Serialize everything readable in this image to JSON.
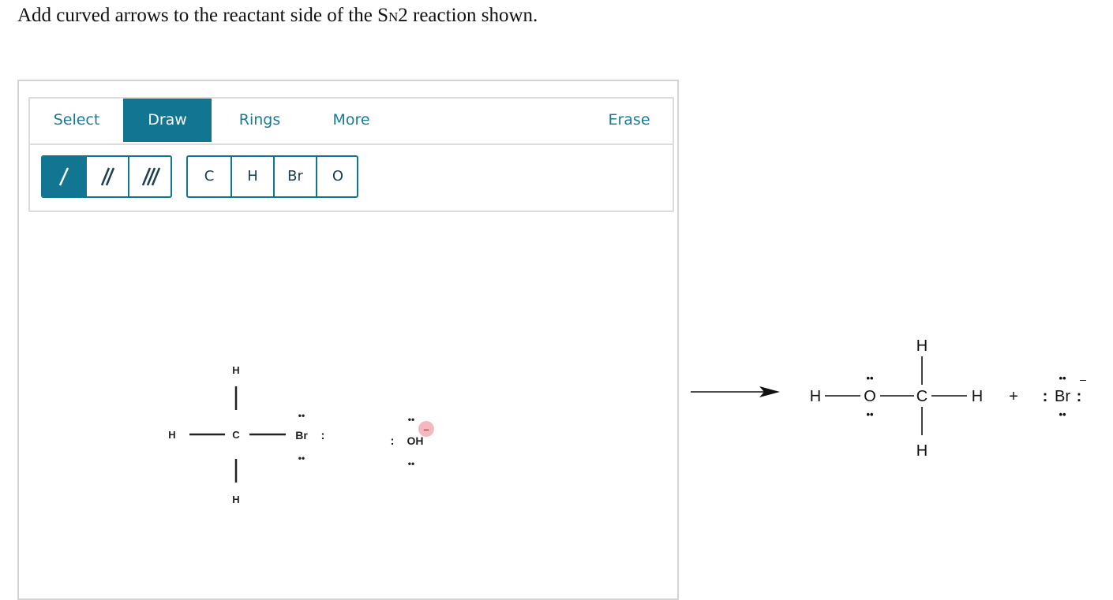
{
  "question": {
    "prefix": "Add curved arrows to the reactant side of the S",
    "subscript": "N",
    "suffix": "2 reaction shown."
  },
  "tabs": [
    {
      "label": "Select",
      "active": false
    },
    {
      "label": "Draw",
      "active": true
    },
    {
      "label": "Rings",
      "active": false
    },
    {
      "label": "More",
      "active": false
    },
    {
      "label": "Erase",
      "active": false
    }
  ],
  "bond_tools": [
    {
      "name": "single-bond",
      "selected": true
    },
    {
      "name": "double-bond",
      "selected": false
    },
    {
      "name": "triple-bond",
      "selected": false
    }
  ],
  "atom_tools": [
    "C",
    "H",
    "Br",
    "O"
  ],
  "reactants": {
    "methyl_bromide": {
      "c": "C",
      "h_top": "H",
      "h_left": "H",
      "h_bottom": "H",
      "br": "Br",
      "br_pair": ":",
      "lone_pair": "••"
    },
    "hydroxide": {
      "label": "OH",
      "pair_left": ":",
      "lone_pair": "••",
      "charge": "–"
    }
  },
  "products": {
    "methanol": {
      "h_left": "H",
      "o": "O",
      "c": "C",
      "h_top": "H",
      "h_right": "H",
      "h_bottom": "H",
      "lone_pair": "••"
    },
    "plus": "+",
    "bromide": {
      "br": "Br",
      "pair_left": ":",
      "pair_right": ":",
      "lone_pair": "••",
      "charge": "–"
    }
  },
  "colors": {
    "accent": "#127591",
    "tab_text": "#1b7a93",
    "charge_bubble": "#f5b8bf",
    "charge_text": "#c0392b"
  }
}
